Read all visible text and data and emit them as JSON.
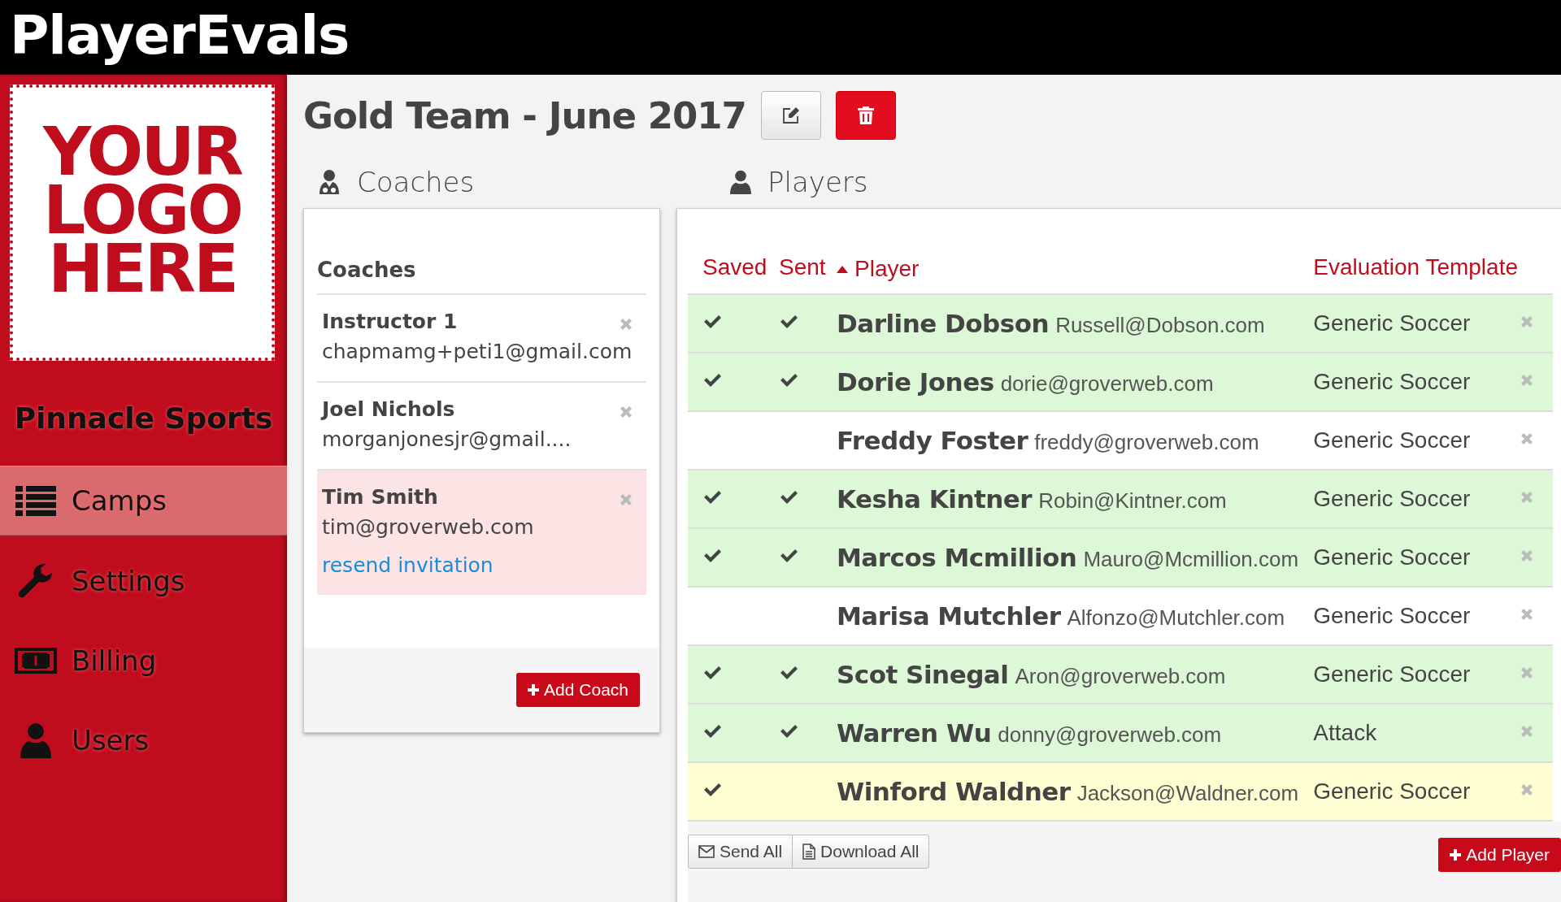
{
  "app": {
    "brand": "PlayerEvals"
  },
  "sidebar": {
    "logo_lines": [
      "YOUR",
      "LOGO",
      "HERE"
    ],
    "org_name": "Pinnacle Sports",
    "items": [
      {
        "label": "Camps",
        "kind": "list",
        "selected": true
      },
      {
        "label": "Settings",
        "kind": "wrench",
        "selected": false
      },
      {
        "label": "Billing",
        "kind": "money",
        "selected": false
      },
      {
        "label": "Users",
        "kind": "user",
        "selected": false
      }
    ]
  },
  "page": {
    "title": "Gold Team - June 2017"
  },
  "coaches": {
    "section_title": "Coaches",
    "heading": "Coaches",
    "add_button": "Add Coach",
    "items": [
      {
        "name": "Instructor 1",
        "email": "chapmamg+peti1@gmail.com",
        "pending": false
      },
      {
        "name": "Joel Nichols",
        "email": "morganjonesjr@gmail....",
        "pending": false
      },
      {
        "name": "Tim Smith",
        "email": "tim@groverweb.com",
        "pending": true,
        "resend_link": "resend invitation"
      }
    ]
  },
  "players": {
    "section_title": "Players",
    "columns": [
      {
        "label": "Saved",
        "sorted": false
      },
      {
        "label": "Sent",
        "sorted": false
      },
      {
        "label": "Player",
        "sorted": true
      },
      {
        "label": "Evaluation Template",
        "sorted": false
      }
    ],
    "rows": [
      {
        "name": "Darline Dobson",
        "email": "Russell@Dobson.com",
        "template": "Generic Soccer",
        "saved": true,
        "sent": true
      },
      {
        "name": "Dorie Jones",
        "email": "dorie@groverweb.com",
        "template": "Generic Soccer",
        "saved": true,
        "sent": true
      },
      {
        "name": "Freddy Foster",
        "email": "freddy@groverweb.com",
        "template": "Generic Soccer",
        "saved": false,
        "sent": false
      },
      {
        "name": "Kesha Kintner",
        "email": "Robin@Kintner.com",
        "template": "Generic Soccer",
        "saved": true,
        "sent": true
      },
      {
        "name": "Marcos Mcmillion",
        "email": "Mauro@Mcmillion.com",
        "template": "Generic Soccer",
        "saved": true,
        "sent": true
      },
      {
        "name": "Marisa Mutchler",
        "email": "Alfonzo@Mutchler.com",
        "template": "Generic Soccer",
        "saved": false,
        "sent": false
      },
      {
        "name": "Scot Sinegal",
        "email": "Aron@groverweb.com",
        "template": "Generic Soccer",
        "saved": true,
        "sent": true
      },
      {
        "name": "Warren Wu",
        "email": "donny@groverweb.com",
        "template": "Attack",
        "saved": true,
        "sent": true
      },
      {
        "name": "Winford Waldner",
        "email": "Jackson@Waldner.com",
        "template": "Generic Soccer",
        "saved": true,
        "sent": false
      }
    ],
    "footer_buttons": [
      {
        "label": "Send All",
        "kind": "envelope"
      },
      {
        "label": "Download All",
        "kind": "file"
      }
    ],
    "add_button": "Add Player"
  }
}
